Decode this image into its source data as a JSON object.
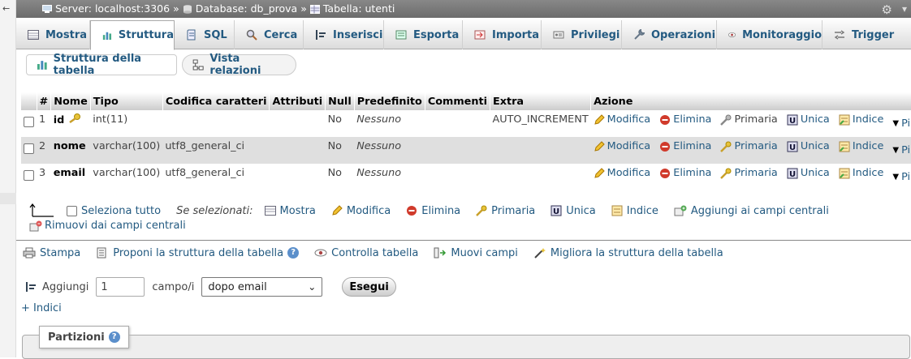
{
  "breadcrumb": {
    "server": "Server: localhost:3306",
    "sep1": "»",
    "database": "Database: db_prova",
    "sep2": "»",
    "table": "Tabella: utenti"
  },
  "tabs": [
    {
      "label": "Mostra",
      "icon": "browse-icon"
    },
    {
      "label": "Struttura",
      "icon": "structure-icon",
      "active": true
    },
    {
      "label": "SQL",
      "icon": "sql-icon"
    },
    {
      "label": "Cerca",
      "icon": "search-icon"
    },
    {
      "label": "Inserisci",
      "icon": "insert-icon"
    },
    {
      "label": "Esporta",
      "icon": "export-icon"
    },
    {
      "label": "Importa",
      "icon": "import-icon"
    },
    {
      "label": "Privilegi",
      "icon": "privileges-icon"
    },
    {
      "label": "Operazioni",
      "icon": "wrench-icon"
    },
    {
      "label": "Monitoraggio",
      "icon": "eye-icon"
    },
    {
      "label": "Trigger",
      "icon": "trigger-icon"
    }
  ],
  "subnav": {
    "structure_label": "Struttura della tabella",
    "relations_label": "Vista relazioni"
  },
  "table": {
    "headers": [
      "#",
      "Nome",
      "Tipo",
      "Codifica caratteri",
      "Attributi",
      "Null",
      "Predefinito",
      "Commenti",
      "Extra",
      "Azione"
    ],
    "rows": [
      {
        "num": "1",
        "name": "id",
        "type": "int(11)",
        "collation": "",
        "attributes": "",
        "null": "No",
        "default": "Nessuno",
        "comments": "",
        "extra": "AUTO_INCREMENT"
      },
      {
        "num": "2",
        "name": "nome",
        "type": "varchar(100)",
        "collation": "utf8_general_ci",
        "attributes": "",
        "null": "No",
        "default": "Nessuno",
        "comments": "",
        "extra": ""
      },
      {
        "num": "3",
        "name": "email",
        "type": "varchar(100)",
        "collation": "utf8_general_ci",
        "attributes": "",
        "null": "No",
        "default": "Nessuno",
        "comments": "",
        "extra": ""
      }
    ],
    "actions": {
      "modify": "Modifica",
      "drop": "Elimina",
      "primary": "Primaria",
      "unique": "Unica",
      "index": "Indice",
      "more": "Più"
    }
  },
  "bulk": {
    "select_all": "Seleziona tutto",
    "with_selected": "Se selezionati:",
    "browse": "Mostra",
    "modify": "Modifica",
    "drop": "Elimina",
    "primary": "Primaria",
    "unique": "Unica",
    "index": "Indice",
    "add_central": "Aggiungi ai campi centrali",
    "remove_central": "Rimuovi dai campi centrali"
  },
  "tools": {
    "print": "Stampa",
    "propose": "Proponi la struttura della tabella",
    "check": "Controlla tabella",
    "move": "Muovi campi",
    "improve": "Migliora la struttura della tabella"
  },
  "add_columns": {
    "label": "Aggiungi",
    "count": "1",
    "unit": "campo/i",
    "position": "dopo email",
    "submit": "Esegui"
  },
  "indexes_link": "+ Indici",
  "partitions_label": "Partizioni",
  "colors": {
    "link": "#235a81",
    "topbar": "#777777",
    "even_row": "#dfdfdf",
    "drop_red": "#d03a2b"
  }
}
